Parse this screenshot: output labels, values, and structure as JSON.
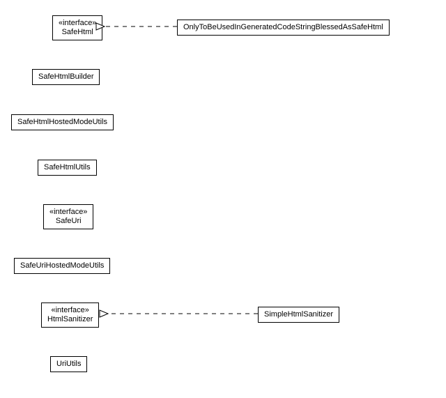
{
  "nodes": {
    "safeHtml": {
      "stereotype": "«interface»",
      "name": "SafeHtml"
    },
    "onlyGenerated": {
      "name": "OnlyToBeUsedInGeneratedCodeStringBlessedAsSafeHtml"
    },
    "safeHtmlBuilder": {
      "name": "SafeHtmlBuilder"
    },
    "safeHtmlHostedModeUtils": {
      "name": "SafeHtmlHostedModeUtils"
    },
    "safeHtmlUtils": {
      "name": "SafeHtmlUtils"
    },
    "safeUri": {
      "stereotype": "«interface»",
      "name": "SafeUri"
    },
    "safeUriHostedModeUtils": {
      "name": "SafeUriHostedModeUtils"
    },
    "htmlSanitizer": {
      "stereotype": "«interface»",
      "name": "HtmlSanitizer"
    },
    "simpleHtmlSanitizer": {
      "name": "SimpleHtmlSanitizer"
    },
    "uriUtils": {
      "name": "UriUtils"
    }
  }
}
